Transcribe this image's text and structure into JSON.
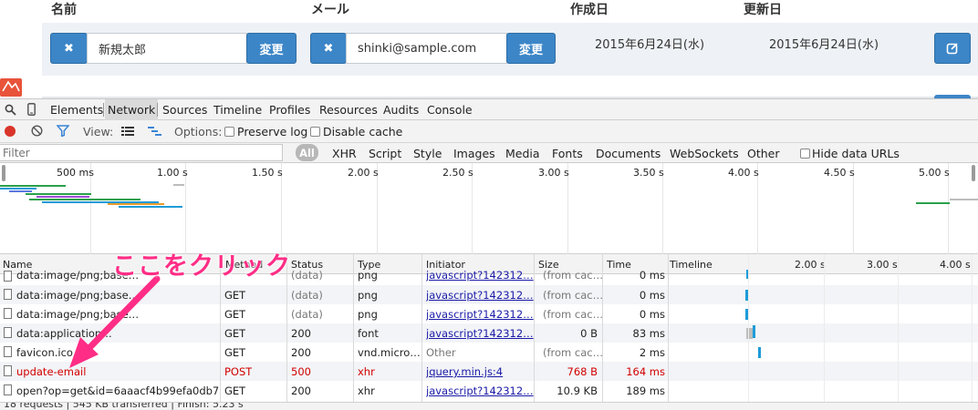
{
  "page": {
    "headers": {
      "name": "名前",
      "email": "メール",
      "created": "作成日",
      "updated": "更新日"
    },
    "row": {
      "name_value": "新規太郎",
      "email_value": "shinki@sample.com",
      "change_label": "変更",
      "delete_glyph": "✖",
      "created": "2015年6月24日(水)",
      "updated": "2015年6月24日(水)"
    }
  },
  "devtools": {
    "tabs": [
      "Elements",
      "Network",
      "Sources",
      "Timeline",
      "Profiles",
      "Resources",
      "Audits",
      "Console"
    ],
    "active_tab": "Network",
    "toolbar": {
      "view_label": "View:",
      "options_label": "Options:",
      "preserve_log": "Preserve log",
      "disable_cache": "Disable cache"
    },
    "filter": {
      "placeholder": "Filter",
      "types": [
        "All",
        "XHR",
        "Script",
        "Style",
        "Images",
        "Media",
        "Fonts",
        "Documents",
        "WebSockets",
        "Other"
      ],
      "active_type": "All",
      "hide_data_urls": "Hide data URLs"
    },
    "overview_ticks": [
      "500 ms",
      "1.00 s",
      "1.50 s",
      "2.00 s",
      "2.50 s",
      "3.00 s",
      "3.50 s",
      "4.00 s",
      "4.50 s",
      "5.00 s"
    ],
    "table": {
      "columns": {
        "name": "Name",
        "method": "Method",
        "status": "Status",
        "type": "Type",
        "initiator": "Initiator",
        "size": "Size",
        "time": "Time",
        "timeline": "Timeline"
      },
      "timeline_ticks": [
        "2.00 s",
        "3.00 s",
        "4.00 s"
      ],
      "rows": [
        {
          "name": "data:image/png;base…",
          "method": "GET",
          "status": "(data)",
          "type": "png",
          "initiator": "javascript?142312…",
          "size": "(from cac…",
          "time": "0 ms"
        },
        {
          "name": "data:image/png;base…",
          "method": "GET",
          "status": "(data)",
          "type": "png",
          "initiator": "javascript?142312…",
          "size": "(from cac…",
          "time": "0 ms"
        },
        {
          "name": "data:image/png;base…",
          "method": "GET",
          "status": "(data)",
          "type": "png",
          "initiator": "javascript?142312…",
          "size": "(from cac…",
          "time": "0 ms"
        },
        {
          "name": "data:application…",
          "method": "GET",
          "status": "200",
          "type": "font",
          "initiator": "javascript?142312…",
          "size": "0 B",
          "time": "83 ms"
        },
        {
          "name": "favicon.ico",
          "method": "GET",
          "status": "200",
          "type": "vnd.micro…",
          "initiator": "Other",
          "size": "(from cac…",
          "time": "2 ms"
        },
        {
          "name": "update-email",
          "method": "POST",
          "status": "500",
          "type": "xhr",
          "initiator": "jquery.min.js:4",
          "size": "768 B",
          "time": "164 ms"
        },
        {
          "name": "open?op=get&id=6aaacf4b99efa0db7…",
          "method": "GET",
          "status": "200",
          "type": "xhr",
          "initiator": "javascript?142312…",
          "size": "10.9 KB",
          "time": "189 ms"
        }
      ]
    },
    "status_bar": "18 requests | 545 KB transferred | Finish: 5.23 s"
  },
  "annotation": {
    "text": "ここをクリック",
    "color": "#ff2d86"
  },
  "colors": {
    "button_blue": "#3c86c8",
    "record_red": "#d9352b",
    "error_red": "#d20000",
    "filter_blue": "#3b85d6"
  }
}
